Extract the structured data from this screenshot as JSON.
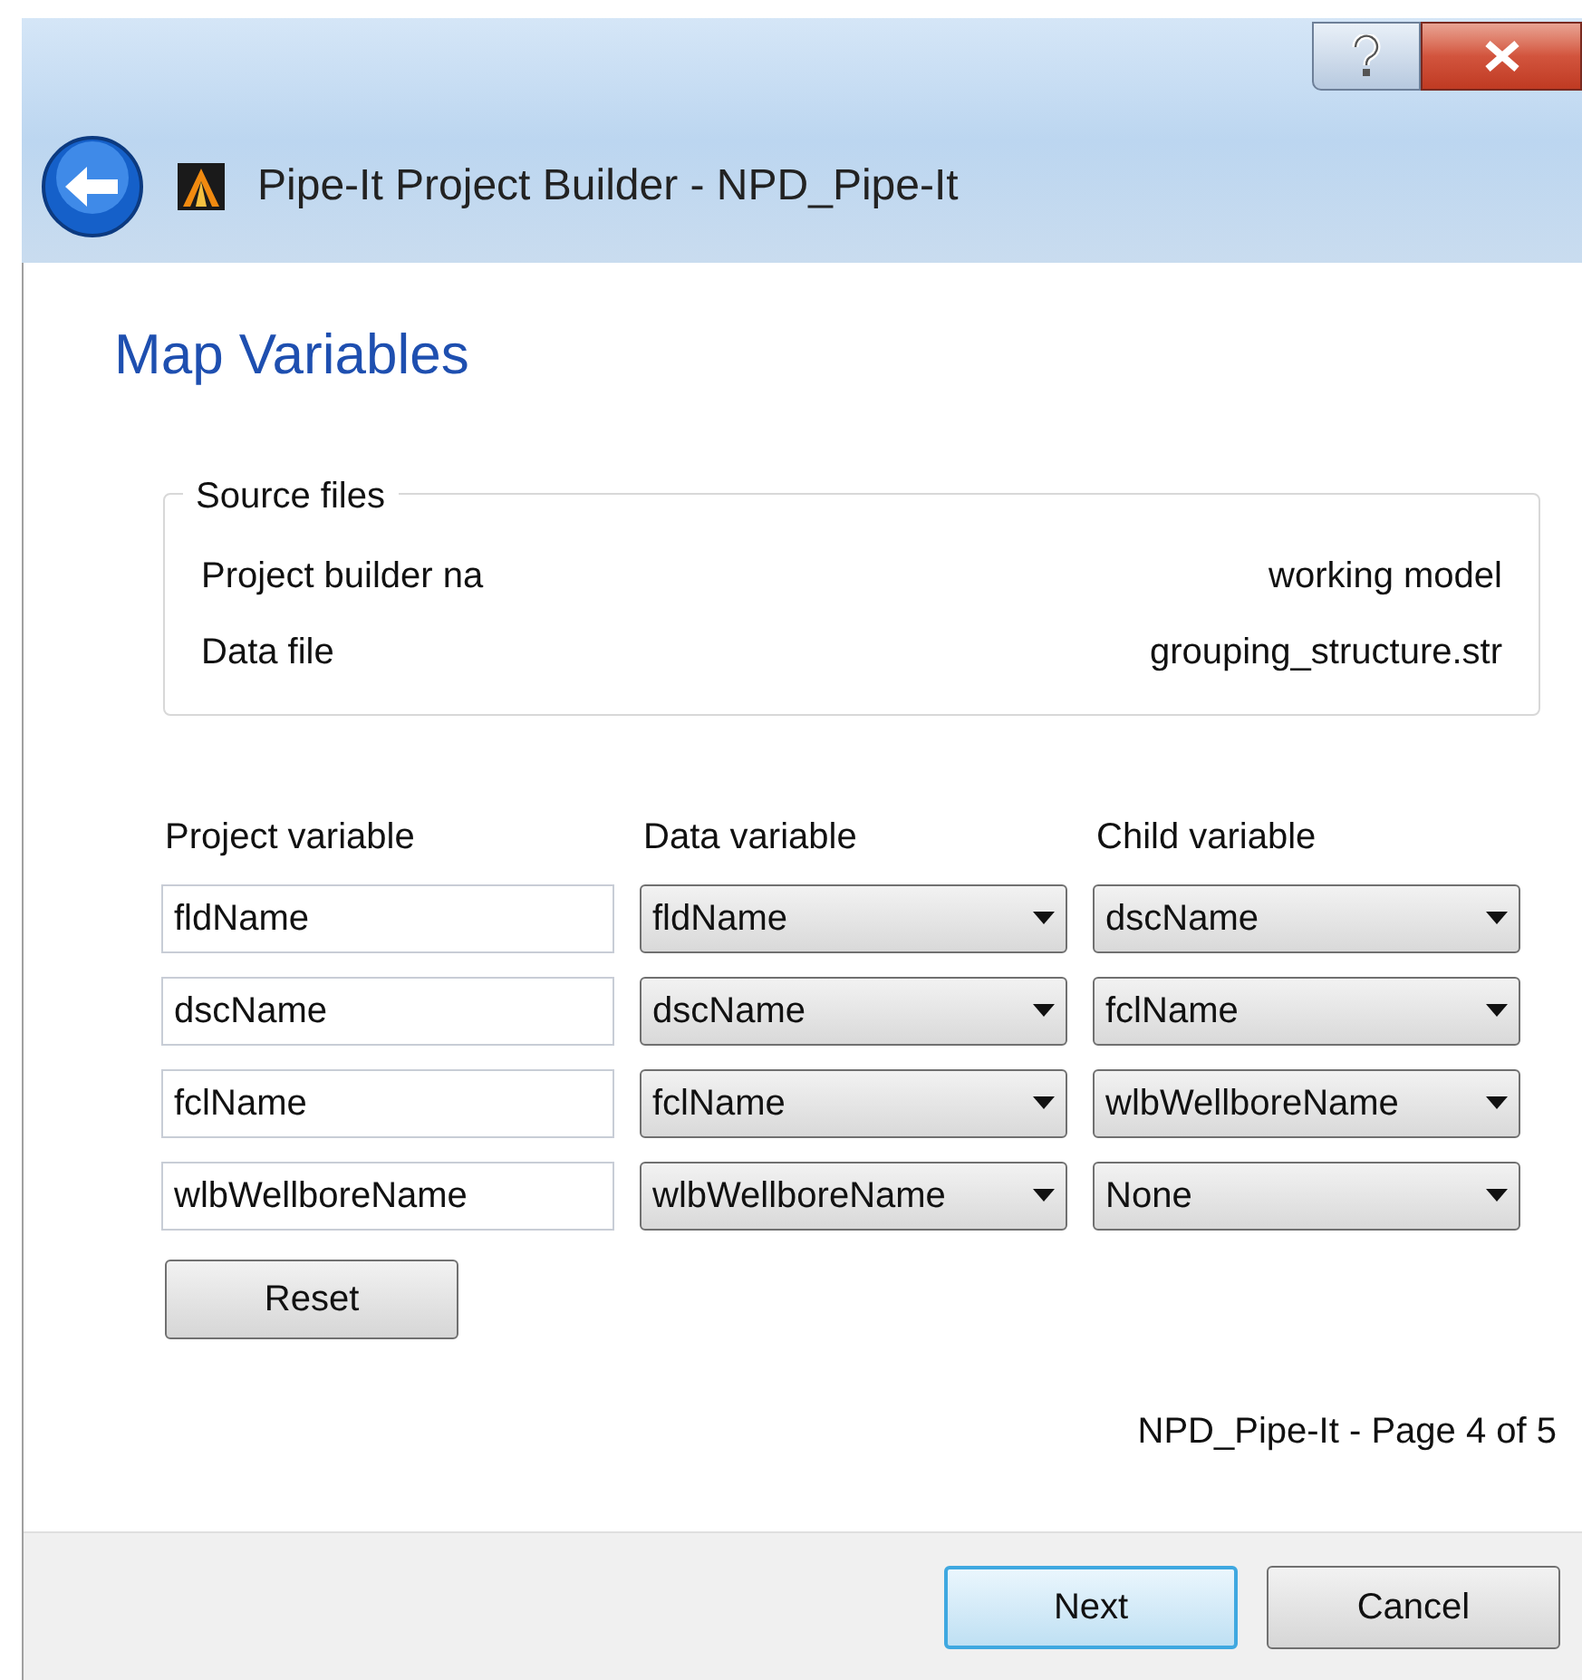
{
  "window": {
    "title": "Pipe-It Project Builder - NPD_Pipe-It"
  },
  "page": {
    "heading": "Map Variables"
  },
  "source_files": {
    "title": "Source files",
    "rows": [
      {
        "label": "Project builder na",
        "value": "working model"
      },
      {
        "label": "Data file",
        "value": "grouping_structure.str"
      }
    ]
  },
  "mapping": {
    "columns": [
      "Project variable",
      "Data variable",
      "Child variable"
    ],
    "rows": [
      {
        "project": "fldName",
        "data": "fldName",
        "child": "dscName"
      },
      {
        "project": "dscName",
        "data": "dscName",
        "child": "fclName"
      },
      {
        "project": "fclName",
        "data": "fclName",
        "child": "wlbWellboreName"
      },
      {
        "project": "wlbWellboreName",
        "data": "wlbWellboreName",
        "child": "None"
      }
    ]
  },
  "reset_button": "Reset",
  "page_status": "NPD_Pipe-It - Page 4 of 5",
  "buttons": [
    {
      "label": "Next",
      "default": true
    },
    {
      "label": "Cancel",
      "default": false
    }
  ]
}
